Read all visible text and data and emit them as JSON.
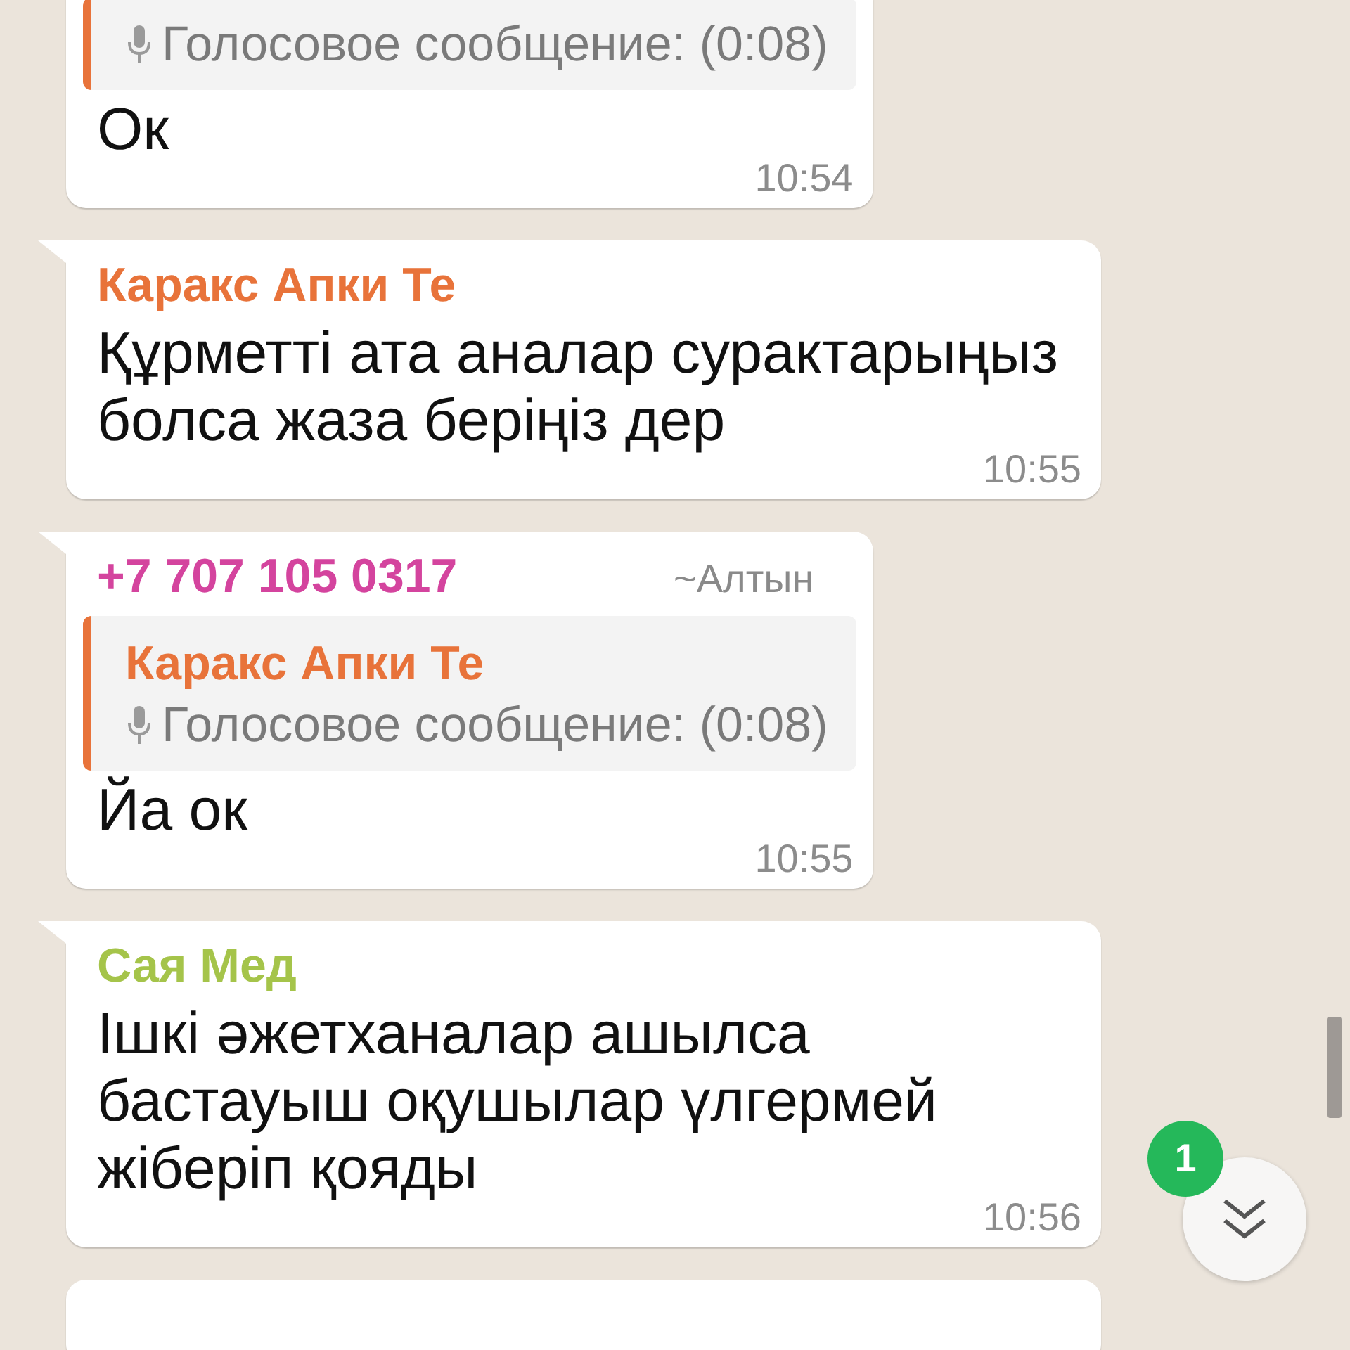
{
  "messages": [
    {
      "quote": {
        "color": "#e8733a",
        "kind": "voice",
        "text": "Голосовое сообщение: (0:08)"
      },
      "text": "Ок",
      "time": "10:54"
    },
    {
      "sender": "Каракс Апки Те",
      "color": "#e8733a",
      "text": "Құрметті ата аналар сурактарыңыз болса жаза беріңіз дер",
      "time": "10:55"
    },
    {
      "sender": "+7 707 105 0317",
      "color": "#d4449e",
      "alias": "~Алтын",
      "quote": {
        "sender": "Каракс Апки Те",
        "color": "#e8733a",
        "kind": "voice",
        "text": "Голосовое сообщение: (0:08)"
      },
      "text": "Йа ок",
      "time": "10:55"
    },
    {
      "sender": "Сая Мед",
      "color": "#a5c44a",
      "text": "Ішкі әжетханалар ашылса бастауыш оқушылар үлгермей жіберіп қояды",
      "time": "10:56"
    },
    {
      "partial": true
    }
  ],
  "scroll_button": {
    "unread": "1"
  }
}
